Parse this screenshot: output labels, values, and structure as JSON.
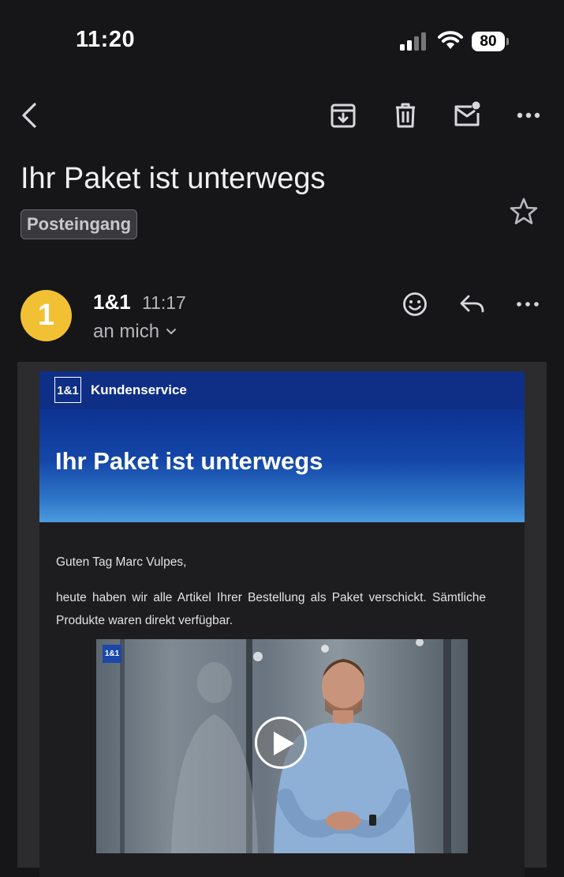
{
  "status_bar": {
    "time": "11:20",
    "battery": "80",
    "icons": [
      "signal-icon",
      "wifi-icon",
      "battery-icon"
    ]
  },
  "toolbar": {
    "icons": [
      "back-icon",
      "archive-icon",
      "trash-icon",
      "mark-unread-icon",
      "more-icon"
    ]
  },
  "email": {
    "subject": "Ihr Paket ist unterwegs",
    "label": "Posteingang",
    "sender": "1&1",
    "time": "11:17",
    "avatar_letter": "1",
    "avatar_color": "#f2c133",
    "recipient": "an mich"
  },
  "content": {
    "brand_logo": "1&1",
    "brand_name": "Kundenservice",
    "hero_title": "Ihr Paket ist unterwegs",
    "greeting": "Guten Tag Marc Vulpes,",
    "paragraph": "heute haben wir alle Artikel Ihrer Bestellung als Paket verschickt. Sämtliche Produkte waren direkt verfügbar.",
    "video_logo": "1&1"
  },
  "colors": {
    "background": "#161618",
    "brand_blue": "#0f2f86"
  }
}
